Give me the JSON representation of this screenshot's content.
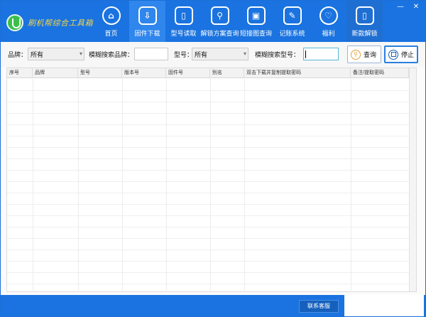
{
  "app": {
    "title": "刷机帮综合工具箱"
  },
  "window_controls": {
    "minimize": "—",
    "close": "✕"
  },
  "nav": [
    {
      "label": "首页",
      "icon": "home-icon",
      "glyph": "⌂",
      "active": false
    },
    {
      "label": "固件下载",
      "icon": "download-icon",
      "glyph": "⇩",
      "active": true
    },
    {
      "label": "型号读取",
      "icon": "phone-icon",
      "glyph": "▯",
      "active": false
    },
    {
      "label": "解锁方案查询",
      "icon": "search-doc-icon",
      "glyph": "⚲",
      "active": false
    },
    {
      "label": "短接图查询",
      "icon": "image-icon",
      "glyph": "▣",
      "active": false
    },
    {
      "label": "记账系统",
      "icon": "edit-icon",
      "glyph": "✎",
      "active": false
    },
    {
      "label": "福利",
      "icon": "heart-icon",
      "glyph": "♡",
      "active": false
    },
    {
      "label": "新款解锁",
      "icon": "unlock-phone-icon",
      "glyph": "▯",
      "active": false
    }
  ],
  "filter": {
    "brand_label": "品牌：",
    "brand_value": "所有",
    "fuzzy_brand_label": "模糊搜索品牌：",
    "fuzzy_brand_value": "",
    "model_label": "型号：",
    "model_value": "所有",
    "fuzzy_model_label": "模糊搜索型号：",
    "fuzzy_model_value": "",
    "query_label": "查询",
    "stop_label": "停止"
  },
  "table": {
    "columns": [
      "序号",
      "品牌",
      "型号",
      "版本号",
      "固件号",
      "别名",
      "双击下载并复制提取密码",
      "备注/提取密码"
    ],
    "rows": []
  },
  "bottom": {
    "contact_label": "联系客服"
  },
  "colors": {
    "brand_blue": "#1a73e0",
    "active_tab": "#2f86ec",
    "logo_green": "#3bbf4a",
    "logo_text": "#f4d44a"
  }
}
